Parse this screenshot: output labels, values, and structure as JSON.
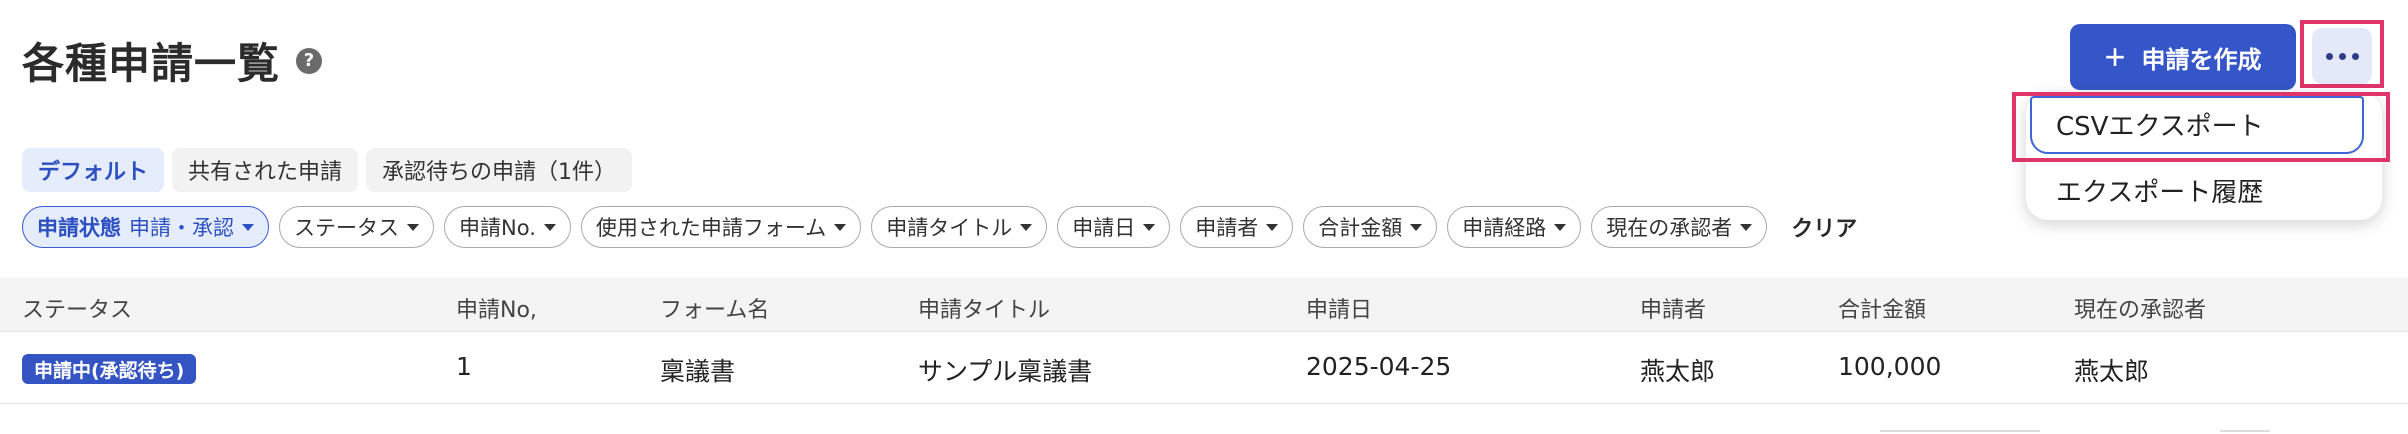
{
  "header": {
    "title": "各種申請一覧",
    "help_icon": "help-icon",
    "create_label": "申請を作成",
    "create_icon": "plus-icon",
    "more_icon": "more-horizontal-icon"
  },
  "menu": {
    "csv_export": "CSVエクスポート",
    "export_history": "エクスポート履歴"
  },
  "tabs": [
    {
      "label": "デフォルト",
      "active": true
    },
    {
      "label": "共有された申請",
      "active": false
    },
    {
      "label": "承認待ちの申請（1件）",
      "active": false
    }
  ],
  "filters": {
    "status_key": "申請状態",
    "status_value": "申請・承認",
    "items": [
      "ステータス",
      "申請No.",
      "使用された申請フォーム",
      "申請タイトル",
      "申請日",
      "申請者",
      "合計金額",
      "申請経路",
      "現在の承認者"
    ],
    "clear": "クリア"
  },
  "table": {
    "columns": [
      "ステータス",
      "申請No,",
      "フォーム名",
      "申請タイトル",
      "申請日",
      "申請者",
      "合計金額",
      "現在の承認者"
    ],
    "rows": [
      {
        "status": "申請中(承認待ち)",
        "no": "1",
        "form": "稟議書",
        "title": "サンプル稟議書",
        "date": "2025-04-25",
        "applicant": "燕太郎",
        "amount": "100,000",
        "approver": "燕太郎"
      }
    ]
  },
  "colors": {
    "primary": "#3556c8",
    "highlight": "#e0356a",
    "chip_selected_bg": "#e5ecfb"
  }
}
